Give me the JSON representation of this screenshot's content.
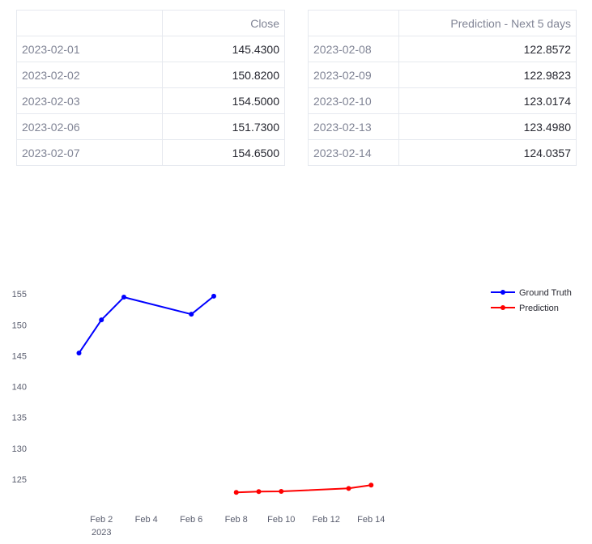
{
  "table_close": {
    "header_index": "",
    "header_value": "Close",
    "rows": [
      {
        "date": "2023-02-01",
        "value": "145.4300"
      },
      {
        "date": "2023-02-02",
        "value": "150.8200"
      },
      {
        "date": "2023-02-03",
        "value": "154.5000"
      },
      {
        "date": "2023-02-06",
        "value": "151.7300"
      },
      {
        "date": "2023-02-07",
        "value": "154.6500"
      }
    ]
  },
  "table_prediction": {
    "header_index": "",
    "header_value": "Prediction - Next 5 days",
    "rows": [
      {
        "date": "2023-02-08",
        "value": "122.8572"
      },
      {
        "date": "2023-02-09",
        "value": "122.9823"
      },
      {
        "date": "2023-02-10",
        "value": "123.0174"
      },
      {
        "date": "2023-02-13",
        "value": "123.4980"
      },
      {
        "date": "2023-02-14",
        "value": "124.0357"
      }
    ]
  },
  "chart_data": {
    "type": "line",
    "title": "",
    "xlabel": "",
    "ylabel": "",
    "x_tick_labels": [
      "Feb 2",
      "Feb 4",
      "Feb 6",
      "Feb 8",
      "Feb 10",
      "Feb 12",
      "Feb 14"
    ],
    "x_tick_dates": [
      "2023-02-02",
      "2023-02-04",
      "2023-02-06",
      "2023-02-08",
      "2023-02-10",
      "2023-02-12",
      "2023-02-14"
    ],
    "x_year_label": "2023",
    "y_ticks": [
      125,
      130,
      135,
      140,
      145,
      150,
      155
    ],
    "xlim": [
      "2023-01-30",
      "2023-02-19"
    ],
    "ylim": [
      120,
      157
    ],
    "grid": false,
    "legend_position": "top-right",
    "series": [
      {
        "name": "Ground Truth",
        "color": "#0000ff",
        "x": [
          "2023-02-01",
          "2023-02-02",
          "2023-02-03",
          "2023-02-06",
          "2023-02-07"
        ],
        "y": [
          145.43,
          150.82,
          154.5,
          151.73,
          154.65
        ]
      },
      {
        "name": "Prediction",
        "color": "#ff0000",
        "x": [
          "2023-02-08",
          "2023-02-09",
          "2023-02-10",
          "2023-02-13",
          "2023-02-14"
        ],
        "y": [
          122.8572,
          122.9823,
          123.0174,
          123.498,
          124.0357
        ]
      }
    ]
  }
}
